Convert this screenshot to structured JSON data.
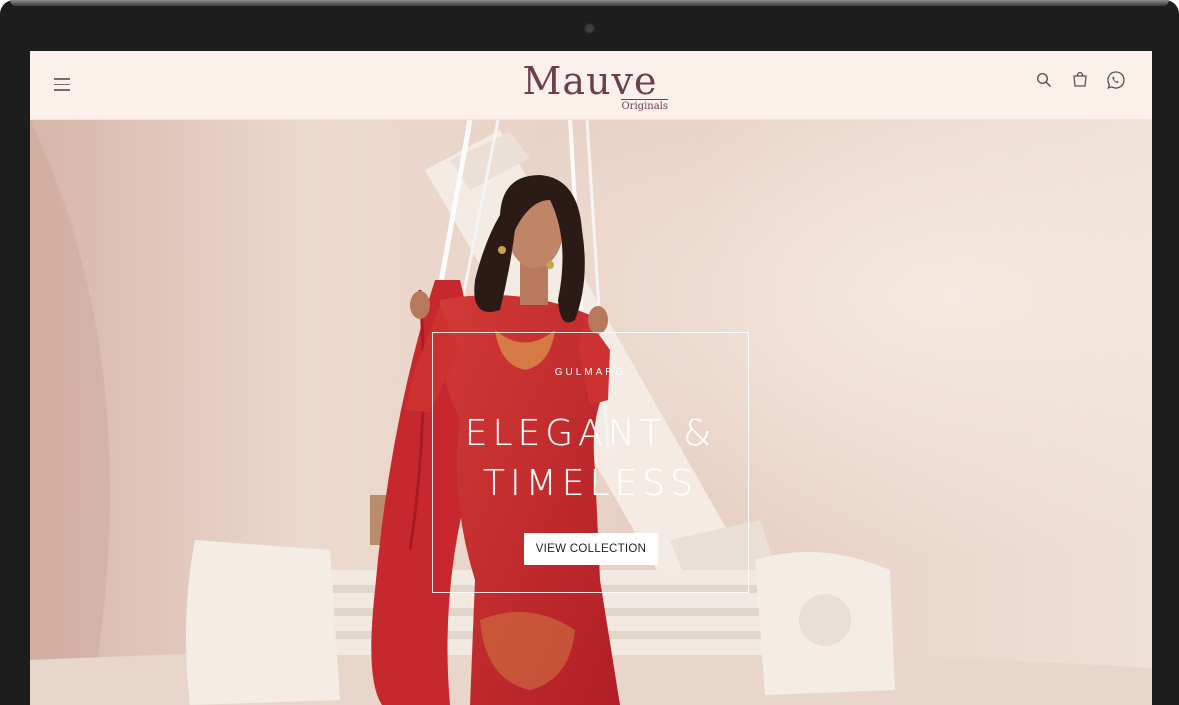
{
  "header": {
    "logo_text": "Mauve",
    "logo_sub": "Originals",
    "icons": [
      "menu-icon",
      "search-icon",
      "cart-icon",
      "whatsapp-icon"
    ]
  },
  "hero": {
    "eyebrow": "GULMARG",
    "title_line1": "ELEGANT &",
    "title_line2": "TIMELESS",
    "button_label": "VIEW COLLECTION"
  },
  "colors": {
    "header_bg": "#fbf1ea",
    "logo": "#6b3f4c",
    "hero_bg": "#e8d4ca",
    "dress_red": "#c8282c",
    "frame": "#1d1d1e"
  }
}
